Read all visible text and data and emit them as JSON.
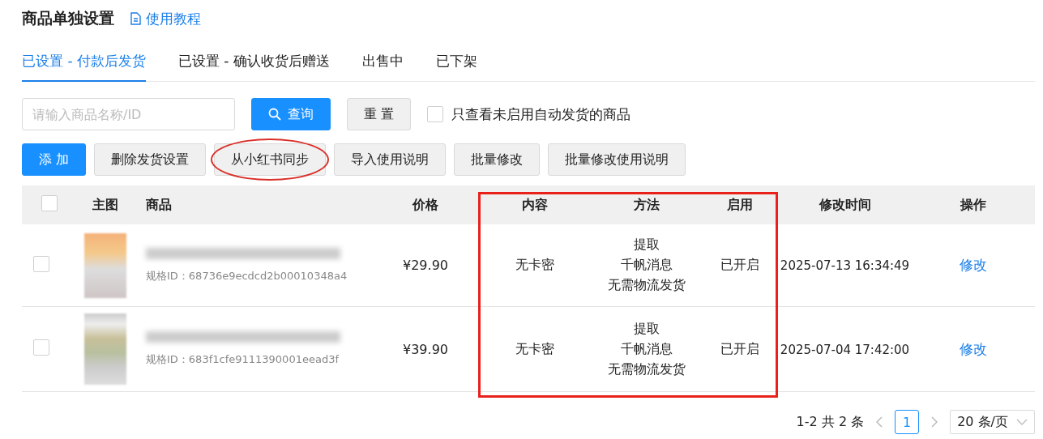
{
  "header": {
    "title": "商品单独设置",
    "tutorial_link": "使用教程"
  },
  "tabs": [
    {
      "label": "已设置 - 付款后发货",
      "selected": true
    },
    {
      "label": "已设置 - 确认收货后赠送",
      "selected": false
    },
    {
      "label": "出售中",
      "selected": false
    },
    {
      "label": "已下架",
      "selected": false
    }
  ],
  "filters": {
    "search": {
      "placeholder": "请输入商品名称/ID"
    },
    "query_button": "查询",
    "reset_button": "重 置",
    "only_disabled": {
      "label": "只查看未启用自动发货的商品",
      "checked": false
    }
  },
  "actions": [
    {
      "label": "添 加",
      "kind": "primary",
      "circled": false
    },
    {
      "label": "删除发货设置",
      "kind": "default",
      "circled": false
    },
    {
      "label": "从小红书同步",
      "kind": "default",
      "circled": true
    },
    {
      "label": "导入使用说明",
      "kind": "default",
      "circled": false
    },
    {
      "label": "批量修改",
      "kind": "default",
      "circled": false
    },
    {
      "label": "批量修改使用说明",
      "kind": "default",
      "circled": false
    }
  ],
  "table": {
    "select_all": {
      "checked": false
    },
    "columns": [
      {
        "label": "主图",
        "highlighted": false
      },
      {
        "label": "商品",
        "highlighted": false
      },
      {
        "label": "价格",
        "highlighted": false
      },
      {
        "label": "内容",
        "highlighted": true
      },
      {
        "label": "方法",
        "highlighted": true
      },
      {
        "label": "启用",
        "highlighted": true
      },
      {
        "label": "修改时间",
        "highlighted": false
      },
      {
        "label": "操作",
        "highlighted": false
      }
    ],
    "rows": [
      {
        "checked": false,
        "sku_id": "规格ID：68736e9ecdcd2b00010348a4",
        "price": "¥29.90",
        "content": "无卡密",
        "method": [
          "提取",
          "千帆消息",
          "无需物流发货"
        ],
        "enabled": "已开启",
        "modified": "2025-07-13 16:34:49",
        "action": "修改"
      },
      {
        "checked": false,
        "sku_id": "规格ID：683f1cfe9111390001eead3f",
        "price": "¥39.90",
        "content": "无卡密",
        "method": [
          "提取",
          "千帆消息",
          "无需物流发货"
        ],
        "enabled": "已开启",
        "modified": "2025-07-04 17:42:00",
        "action": "修改"
      }
    ]
  },
  "pagination": {
    "summary": "1-2 共 2 条",
    "pages": [
      {
        "label": "1",
        "selected": true
      }
    ],
    "page_size": "20 条/页"
  }
}
